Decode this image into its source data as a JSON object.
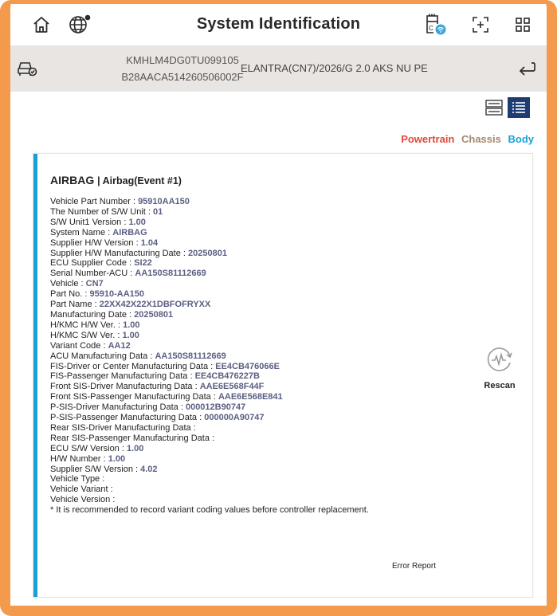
{
  "header": {
    "title": "System Identification",
    "icons": [
      "home-icon",
      "globe-icon",
      "vci-status-icon",
      "screenshot-icon",
      "menu-grid-icon"
    ]
  },
  "vehicle": {
    "vin": "KMHLM4DG0TU099105",
    "code": "B28AACA514260506002F",
    "model": "ELANTRA(CN7)/2026/G 2.0 AKS NU PE",
    "icons": [
      "car-status-icon",
      "return-icon"
    ]
  },
  "view": {
    "icons": [
      "card-view-icon",
      "list-view-icon"
    ],
    "selected": "list-view-icon"
  },
  "tabs": [
    {
      "label": "Powertrain",
      "color": "#e0493a"
    },
    {
      "label": "Chassis",
      "color": "#a6896e"
    },
    {
      "label": "Body",
      "color": "#1aa0d8"
    }
  ],
  "card": {
    "title": "AIRBAG",
    "subtitle": "Airbag(Event #1)",
    "rows": [
      {
        "label": "Vehicle Part Number",
        "value": "95910AA150"
      },
      {
        "label": "The Number of S/W Unit",
        "value": "01"
      },
      {
        "label": "S/W Unit1 Version",
        "value": "1.00"
      },
      {
        "label": "System Name",
        "value": "AIRBAG"
      },
      {
        "label": "Supplier H/W Version",
        "value": "1.04"
      },
      {
        "label": "Supplier H/W Manufacturing Date",
        "value": "20250801"
      },
      {
        "label": "ECU Supplier Code",
        "value": "SI22"
      },
      {
        "label": "Serial Number-ACU",
        "value": "AA150S81112669"
      },
      {
        "label": "Vehicle",
        "value": "CN7"
      },
      {
        "label": "Part No.",
        "value": "95910-AA150"
      },
      {
        "label": "Part Name",
        "value": "22XX42X22X1DBFOFRYXX"
      },
      {
        "label": "Manufacturing Date",
        "value": "20250801"
      },
      {
        "label": "H/KMC H/W Ver.",
        "value": "1.00"
      },
      {
        "label": "H/KMC S/W Ver.",
        "value": "1.00"
      },
      {
        "label": "Variant Code",
        "value": "AA12"
      },
      {
        "label": "ACU Manufacturing Data",
        "value": "AA150S81112669"
      },
      {
        "label": "FIS-Driver or Center Manufacturing Data",
        "value": "EE4CB476066E"
      },
      {
        "label": "FIS-Passenger Manufacturing Data",
        "value": "EE4CB476227B"
      },
      {
        "label": "Front SIS-Driver Manufacturing Data",
        "value": "AAE6E568F44F"
      },
      {
        "label": "Front SIS-Passenger Manufacturing Data",
        "value": "AAE6E568E841"
      },
      {
        "label": "P-SIS-Driver Manufacturing Data",
        "value": "000012B90747"
      },
      {
        "label": "P-SIS-Passenger Manufacturing Data",
        "value": "000000A90747"
      },
      {
        "label": "Rear SIS-Driver Manufacturing Data",
        "value": ""
      },
      {
        "label": "Rear SIS-Passenger Manufacturing Data",
        "value": ""
      },
      {
        "label": "ECU S/W Version",
        "value": "1.00"
      },
      {
        "label": "H/W Number",
        "value": "1.00"
      },
      {
        "label": "Supplier S/W Version",
        "value": "4.02"
      },
      {
        "label": "Vehicle Type",
        "value": ""
      },
      {
        "label": "Vehicle Variant",
        "value": ""
      },
      {
        "label": "Vehicle Version",
        "value": ""
      }
    ],
    "note": "* It is recommended to record variant coding values before controller replacement.",
    "rescan_label": "Rescan",
    "error_report_label": "Error Report",
    "rescan_icon": "rescan-icon"
  }
}
